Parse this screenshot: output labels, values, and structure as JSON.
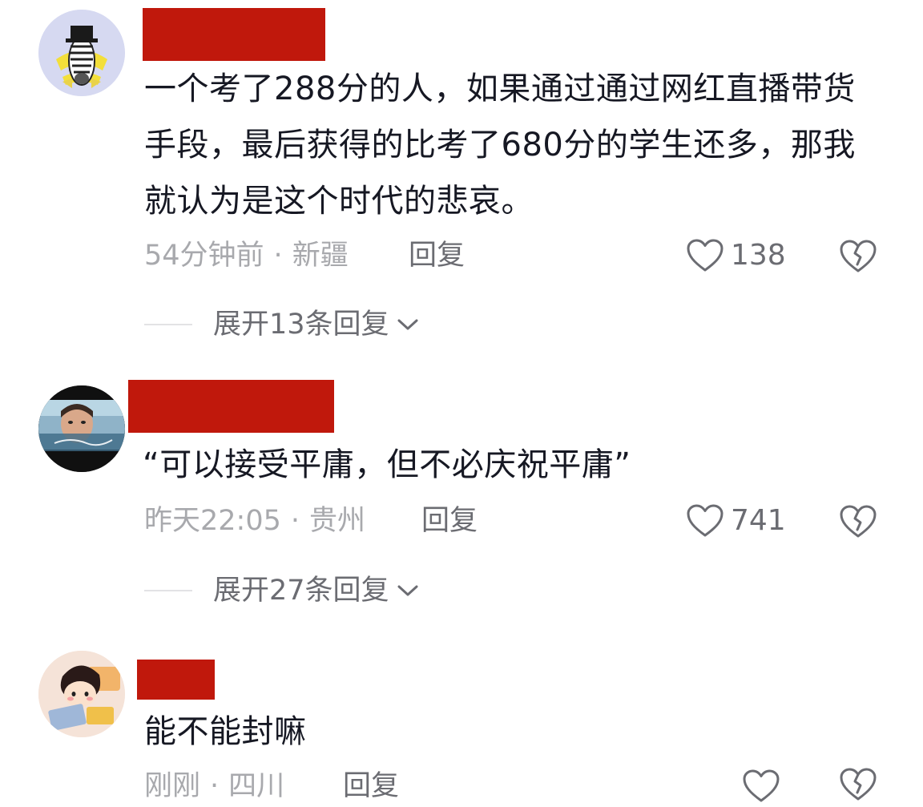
{
  "comments": [
    {
      "text": "一个考了288分的人，如果通过通过网红直播带货手段，最后获得的比考了680分的学生还多，那我就认为是这个时代的悲哀。",
      "time": "54分钟前",
      "separator": "·",
      "location": "新疆",
      "reply_label": "回复",
      "likes": "138",
      "expand_label": "展开13条回复",
      "avatar_icon": "zebra-tophat-avatar"
    },
    {
      "text": "“可以接受平庸，但不必庆祝平庸”",
      "time": "昨天22:05",
      "separator": "·",
      "location": "贵州",
      "reply_label": "回复",
      "likes": "741",
      "expand_label": "展开27条回复",
      "avatar_icon": "child-photo-avatar"
    },
    {
      "text": "能不能封嘛",
      "time": "刚刚",
      "separator": "·",
      "location": "四川",
      "reply_label": "回复",
      "likes": "",
      "avatar_icon": "cartoon-girl-avatar"
    }
  ],
  "colors": {
    "redaction": "#c0180c",
    "text_primary": "#161823",
    "text_meta": "#a8a9ad",
    "text_action": "#6b6c72"
  },
  "icons": {
    "like": "heart-outline-icon",
    "dislike": "broken-heart-icon",
    "expand": "chevron-down-icon"
  }
}
